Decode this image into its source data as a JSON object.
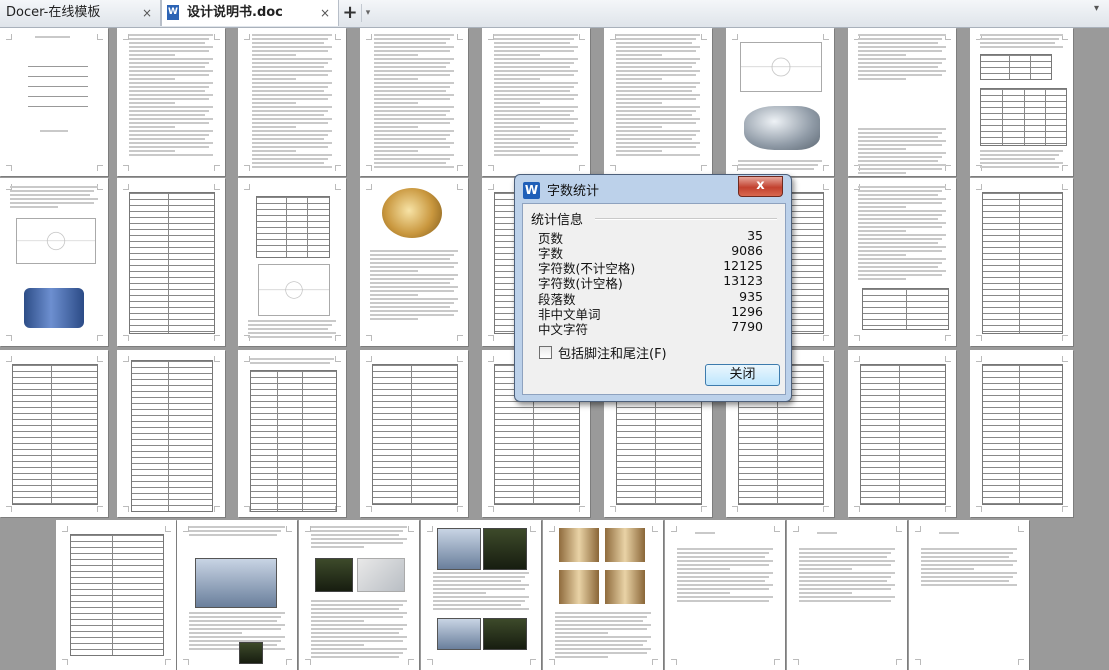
{
  "tabs": [
    {
      "label": "Docer-在线模板",
      "close": "×",
      "active": false
    },
    {
      "label": "设计说明书.doc",
      "close": "×",
      "active": true,
      "icon": "W"
    }
  ],
  "tabbar": {
    "new_tab": "+",
    "dropdown": "▾",
    "overflow": "▾"
  },
  "dialog": {
    "icon": "W",
    "title": "字数统计",
    "close_glyph": "x",
    "group_label": "统计信息",
    "stats": [
      {
        "label": "页数",
        "value": "35"
      },
      {
        "label": "字数",
        "value": "9086"
      },
      {
        "label": "字符数(不计空格)",
        "value": "12125"
      },
      {
        "label": "字符数(计空格)",
        "value": "13123"
      },
      {
        "label": "段落数",
        "value": "935"
      },
      {
        "label": "非中文单词",
        "value": "1296"
      },
      {
        "label": "中文字符",
        "value": "7790"
      }
    ],
    "checkbox_label": "包括脚注和尾注(F)",
    "checkbox_checked": false,
    "close_button": "关闭"
  },
  "document": {
    "page_count_visible": 35
  }
}
